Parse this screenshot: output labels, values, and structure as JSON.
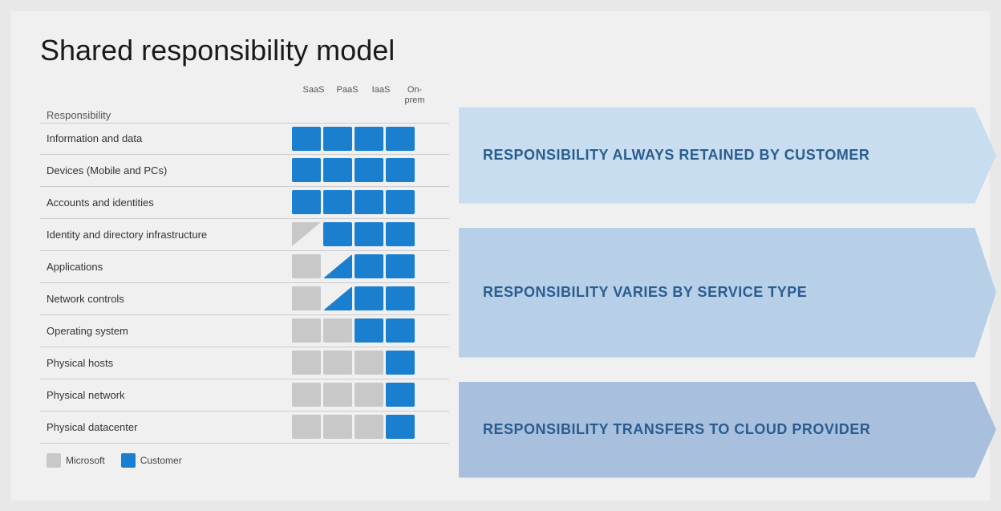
{
  "title": "Shared responsibility model",
  "columns": {
    "headers": [
      "SaaS",
      "PaaS",
      "IaaS",
      "On-\nprem"
    ]
  },
  "rows": [
    {
      "label": "Information and data",
      "cells": [
        "blue",
        "blue",
        "blue",
        "blue"
      ]
    },
    {
      "label": "Devices (Mobile and PCs)",
      "cells": [
        "blue",
        "blue",
        "blue",
        "blue"
      ]
    },
    {
      "label": "Accounts and identities",
      "cells": [
        "blue",
        "blue",
        "blue",
        "blue"
      ]
    },
    {
      "label": "Identity and directory infrastructure",
      "cells": [
        "half",
        "blue",
        "blue",
        "blue"
      ]
    },
    {
      "label": "Applications",
      "cells": [
        "gray",
        "half",
        "blue",
        "blue"
      ]
    },
    {
      "label": "Network controls",
      "cells": [
        "gray",
        "half",
        "blue",
        "blue"
      ]
    },
    {
      "label": "Operating system",
      "cells": [
        "gray",
        "gray",
        "blue",
        "blue"
      ]
    },
    {
      "label": "Physical hosts",
      "cells": [
        "gray",
        "gray",
        "gray",
        "blue"
      ]
    },
    {
      "label": "Physical network",
      "cells": [
        "gray",
        "gray",
        "gray",
        "blue"
      ]
    },
    {
      "label": "Physical datacenter",
      "cells": [
        "gray",
        "gray",
        "gray",
        "blue"
      ]
    }
  ],
  "arrows": [
    {
      "text": "RESPONSIBILITY ALWAYS RETAINED BY CUSTOMER"
    },
    {
      "text": "RESPONSIBILITY VARIES BY SERVICE TYPE"
    },
    {
      "text": "RESPONSIBILITY TRANSFERS TO CLOUD PROVIDER"
    }
  ],
  "legend": {
    "items": [
      {
        "color": "gray",
        "label": "Microsoft"
      },
      {
        "color": "blue",
        "label": "Customer"
      }
    ]
  }
}
